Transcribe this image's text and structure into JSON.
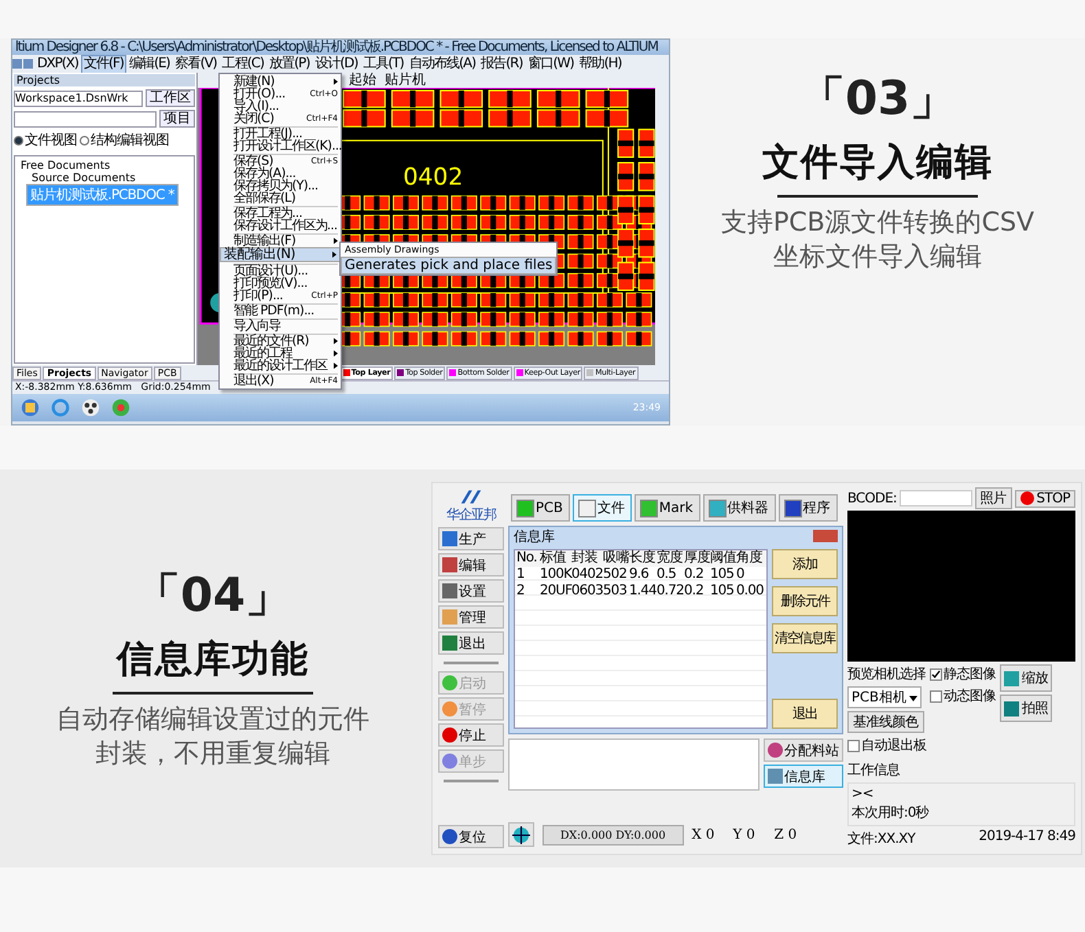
{
  "altium_window": {
    "title": "ltium Designer 6.8 - C:\\Users\\Administrator\\Desktop\\贴片机测试板.PCBDOC * - Free Documents, Licensed to ALTIUM",
    "menu_bar": [
      {
        "label": "DXP(X)",
        "selected": false
      },
      {
        "label": "文件(F)",
        "selected": true
      },
      {
        "label": "编辑(E)",
        "selected": false
      },
      {
        "label": "察看(V)",
        "selected": false
      },
      {
        "label": "工程(C)",
        "selected": false
      },
      {
        "label": "放置(P)",
        "selected": false
      },
      {
        "label": "设计(D)",
        "selected": false
      },
      {
        "label": "工具(T)",
        "selected": false
      },
      {
        "label": "自动布线(A)",
        "selected": false
      },
      {
        "label": "报告(R)",
        "selected": false
      },
      {
        "label": "窗口(W)",
        "selected": false
      },
      {
        "label": "帮助(H)",
        "selected": false
      }
    ],
    "panel": {
      "title": "Projects",
      "workspace": "Workspace1.DsnWrk",
      "workspace_button": "工作区",
      "project_button": "项目",
      "views": [
        {
          "label": "文件视图",
          "selected": true
        },
        {
          "label": "结构编辑视图",
          "selected": false
        }
      ],
      "tree": [
        {
          "label": "Free Documents",
          "selected": false,
          "children": [
            {
              "label": "Source Documents",
              "selected": false,
              "children": [
                {
                  "label": "贴片机测试板.PCBDOC *",
                  "selected": true
                }
              ]
            }
          ]
        }
      ]
    },
    "doc_tabs": [
      "起始",
      "贴片机"
    ],
    "board_label": "0402",
    "file_menu": [
      [
        {
          "label": "新建(N)",
          "submenu": true,
          "selected": false
        },
        {
          "label": "打开(O)...",
          "shortcut": "Ctrl+O",
          "selected": false
        },
        {
          "label": "导入(I)...",
          "selected": false
        },
        {
          "label": "关闭(C)",
          "shortcut": "Ctrl+F4",
          "selected": false
        }
      ],
      [
        {
          "label": "打开工程(J)...",
          "selected": false
        },
        {
          "label": "打开设计工作区(K)...",
          "selected": false
        }
      ],
      [
        {
          "label": "保存(S)",
          "shortcut": "Ctrl+S",
          "selected": false
        },
        {
          "label": "保存为(A)...",
          "selected": false
        },
        {
          "label": "保存拷贝为(Y)...",
          "selected": false
        },
        {
          "label": "全部保存(L)",
          "selected": false
        }
      ],
      [
        {
          "label": "保存工程为...",
          "selected": false
        },
        {
          "label": "保存设计工作区为...",
          "selected": false
        }
      ],
      [
        {
          "label": "制造输出(F)",
          "submenu": true,
          "selected": false
        },
        {
          "label": "装配输出(N)",
          "submenu": true,
          "selected": true
        }
      ],
      [
        {
          "label": "页面设计(U)...",
          "selected": false
        },
        {
          "label": "打印预览(V)...",
          "selected": false
        },
        {
          "label": "打印(P)...",
          "shortcut": "Ctrl+P",
          "selected": false
        }
      ],
      [
        {
          "label": "智能 PDF(m)...",
          "selected": false
        }
      ],
      [
        {
          "label": "导入向导",
          "selected": false
        }
      ],
      [
        {
          "label": "最近的文件(R)",
          "submenu": true,
          "selected": false
        },
        {
          "label": "最近的工程",
          "submenu": true,
          "selected": false
        },
        {
          "label": "最近的设计工作区",
          "submenu": true,
          "selected": false
        }
      ],
      [
        {
          "label": "退出(X)",
          "shortcut": "Alt+F4",
          "selected": false
        }
      ]
    ],
    "submenu": [
      {
        "label": "Assembly Drawings",
        "selected": false
      },
      {
        "label": "Generates pick and place files",
        "selected": true
      }
    ],
    "panel_tabs": [
      {
        "label": "Files",
        "selected": false
      },
      {
        "label": "Projects",
        "selected": true
      },
      {
        "label": "Navigator",
        "selected": false
      },
      {
        "label": "PCB",
        "selected": false
      }
    ],
    "layer_tabs": [
      {
        "label": "Top Layer",
        "color": "#ff0000",
        "selected": true
      },
      {
        "label": "Top Solder",
        "color": "#800080",
        "selected": false
      },
      {
        "label": "Bottom Solder",
        "color": "#ff00ff",
        "selected": false
      },
      {
        "label": "Keep-Out Layer",
        "color": "#ff00ff",
        "selected": false
      },
      {
        "label": "Multi-Layer",
        "color": "#c0c0c0",
        "selected": false
      }
    ],
    "status": "X:-8.382mm Y:8.636mm   Grid:0.254mm",
    "clock": "23:49"
  },
  "feature_03": {
    "number": "「03」",
    "title": "文件导入编辑",
    "lines": [
      "支持PCB源文件转换的CSV",
      "坐标文件导入编辑"
    ]
  },
  "feature_04": {
    "number": "「04」",
    "title": "信息库功能",
    "lines": [
      "自动存储编辑设置过的元件",
      "封装，不用重复编辑"
    ]
  },
  "smt_window": {
    "logo": "华企亚邦",
    "toolbar": [
      {
        "label": "PCB",
        "selected": false
      },
      {
        "label": "文件",
        "selected": true
      },
      {
        "label": "Mark",
        "selected": false
      },
      {
        "label": "供料器",
        "selected": false
      },
      {
        "label": "程序",
        "selected": false
      }
    ],
    "side_buttons": [
      "生产",
      "编辑",
      "设置",
      "管理",
      "退出"
    ],
    "run_buttons": [
      {
        "label": "启动",
        "disabled": true
      },
      {
        "label": "暂停",
        "disabled": true
      },
      {
        "label": "停止",
        "disabled": false
      },
      {
        "label": "单步",
        "disabled": true
      }
    ],
    "reset_button": "复位",
    "dialog": {
      "title": "信息库",
      "columns": [
        "No.",
        "标值",
        "封装",
        "吸嘴",
        "长度",
        "宽度",
        "厚度",
        "阈值",
        "角度"
      ],
      "rows": [
        [
          "1",
          "100K",
          "0402",
          "502",
          "9.6",
          "0.5",
          "0.2",
          "105",
          "0"
        ],
        [
          "2",
          "20UF",
          "0603",
          "503",
          "1.44",
          "0.72",
          "0.2",
          "105",
          "0.00"
        ]
      ],
      "buttons": [
        "添加",
        "删除元件",
        "清空信息库"
      ],
      "exit_button": "退出"
    },
    "assign_button": "分配料站",
    "library_button": "信息库",
    "offset": "DX:0.000 DY:0.000",
    "coords": [
      {
        "axis": "X",
        "value": "0"
      },
      {
        "axis": "Y",
        "value": "0"
      },
      {
        "axis": "Z",
        "value": "0"
      }
    ],
    "bcode_label": "BCODE:",
    "photo_button": "照片",
    "stop_button": "STOP",
    "camera_label": "预览相机选择",
    "camera_select": "PCB相机",
    "image_modes": [
      {
        "label": "静态图像",
        "checked": true
      },
      {
        "label": "动态图像",
        "checked": false
      }
    ],
    "zoom_button": "缩放",
    "capture_button": "拍照",
    "baseline_button": "基准线颜色",
    "auto_exit": {
      "label": "自动退出板",
      "checked": false
    },
    "work_info_title": "工作信息",
    "work_info": [
      "><",
      "本次用时:0秒"
    ],
    "file_label": "文件:XX.XY",
    "timestamp": "2019-4-17 8:49"
  }
}
